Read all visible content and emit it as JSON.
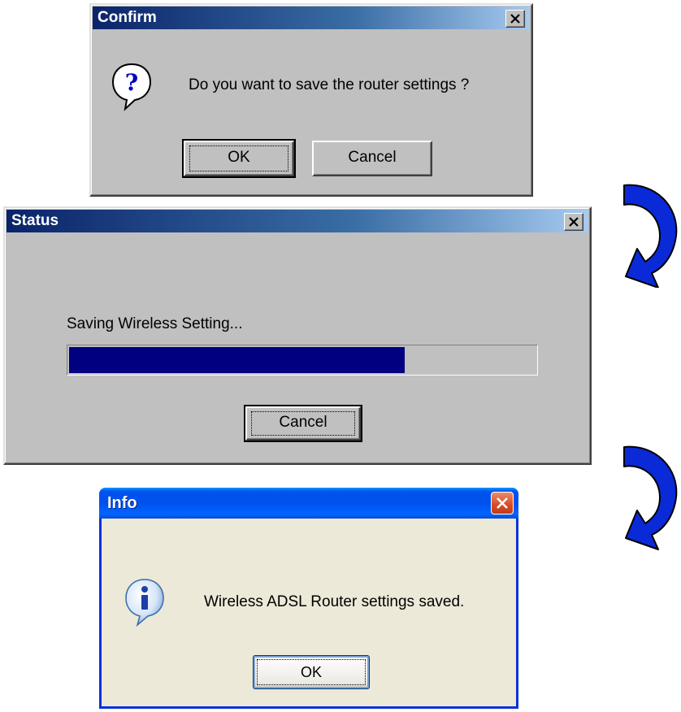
{
  "confirm": {
    "title": "Confirm",
    "message": "Do you want to save the router settings ?",
    "ok_label": "OK",
    "cancel_label": "Cancel",
    "icon": "question-icon"
  },
  "status": {
    "title": "Status",
    "message": "Saving Wireless Setting...",
    "progress": 0.72,
    "cancel_label": "Cancel"
  },
  "info": {
    "title": "Info",
    "message": "Wireless ADSL Router settings saved.",
    "ok_label": "OK",
    "icon": "info-icon"
  },
  "colors": {
    "classic_face": "#c0c0c0",
    "classic_title": "#0a246a",
    "progress_fill": "#000080",
    "xp_face": "#ece9d8",
    "xp_title": "#0053ee",
    "arrow": "#0a2ad8"
  }
}
